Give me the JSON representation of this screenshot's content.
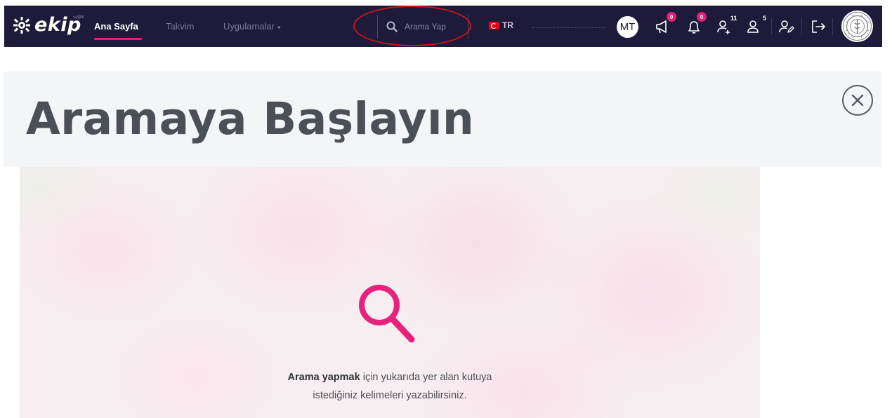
{
  "navbar": {
    "logo_text": "ekip",
    "logo_sup": "sağlık",
    "links": [
      {
        "label": "Ana Sayfa",
        "active": true
      },
      {
        "label": "Takvim",
        "active": false
      },
      {
        "label": "Uygulamalar",
        "active": false,
        "has_dropdown": true
      }
    ],
    "search": {
      "placeholder": "Arama Yap",
      "icon": "search-icon"
    },
    "language": "TR",
    "avatar_initials": "MT",
    "announcements_badge": "0",
    "notifications_badge": "0",
    "user_requests_count": "11",
    "users_count": "5",
    "icons": [
      "megaphone-icon",
      "bell-icon",
      "user-add-icon",
      "users-icon",
      "user-edit-icon",
      "logout-icon",
      "ministry-seal"
    ]
  },
  "header": {
    "title": "Aramaya Başlayın",
    "close_icon": "close-icon"
  },
  "hero": {
    "icon": "search-icon",
    "text_bold": "Arama yapmak",
    "text_line1": " için yukarıda yer alan kutuya",
    "text_line2": "istediğiniz kelimeleri yazabilirsiniz."
  },
  "colors": {
    "navbar_bg": "#1d1a3a",
    "accent": "#e0217a",
    "annotation": "#c9161c",
    "header_bg": "#f4f5f6",
    "title": "#4b4f56"
  }
}
